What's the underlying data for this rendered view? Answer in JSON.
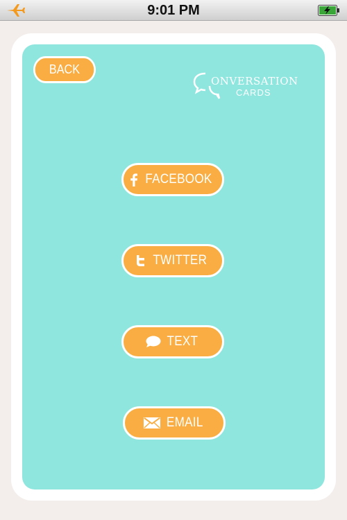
{
  "status_bar": {
    "time": "9:01 PM",
    "airplane_icon": "airplane-icon",
    "battery_icon": "battery-charging-icon"
  },
  "header": {
    "back_label": "BACK",
    "logo": {
      "line1": "ONVERSATION",
      "line2": "CARDS"
    }
  },
  "share": {
    "facebook": {
      "label": "FACEBOOK",
      "icon": "facebook-icon"
    },
    "twitter": {
      "label": "TWITTER",
      "icon": "twitter-icon"
    },
    "text": {
      "label": "TEXT",
      "icon": "speech-bubble-icon"
    },
    "email": {
      "label": "EMAIL",
      "icon": "envelope-icon"
    }
  },
  "colors": {
    "background": "#f3eeec",
    "card": "#8ee6de",
    "button": "#f9ad42",
    "button_text": "#ffffff",
    "airplane": "#f39a1e",
    "battery": "#3aa63a"
  }
}
